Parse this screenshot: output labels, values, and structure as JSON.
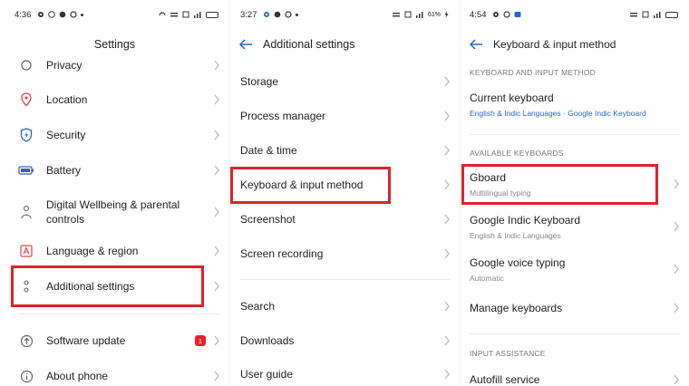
{
  "colors": {
    "accent": "#2a66c8",
    "highlight": "#e3202a",
    "badge": "#e8212b"
  },
  "screen1": {
    "status_time": "4:36",
    "title": "Settings",
    "items": [
      {
        "label": "Privacy",
        "icon": "privacy-icon"
      },
      {
        "label": "Location",
        "icon": "location-pin-icon"
      },
      {
        "label": "Security",
        "icon": "shield-icon"
      },
      {
        "label": "Battery",
        "icon": "battery-icon"
      },
      {
        "label": "Digital Wellbeing & parental controls",
        "icon": "wellbeing-icon"
      },
      {
        "label": "Language & region",
        "icon": "language-icon"
      },
      {
        "label": "Additional settings",
        "icon": "more-dots-icon"
      },
      {
        "label": "Software update",
        "icon": "update-icon",
        "badge": "1"
      },
      {
        "label": "About phone",
        "icon": "info-icon"
      }
    ]
  },
  "screen2": {
    "status_time": "3:27",
    "status_battery": "61%",
    "title": "Additional settings",
    "items": [
      {
        "label": "Storage"
      },
      {
        "label": "Process manager"
      },
      {
        "label": "Date & time"
      },
      {
        "label": "Keyboard & input method"
      },
      {
        "label": "Screenshot"
      },
      {
        "label": "Screen recording"
      },
      {
        "label": "Search"
      },
      {
        "label": "Downloads"
      },
      {
        "label": "User guide"
      }
    ]
  },
  "screen3": {
    "status_time": "4:54",
    "title": "Keyboard & input method",
    "section_keyboard": "KEYBOARD AND INPUT METHOD",
    "current_keyboard": {
      "label": "Current keyboard",
      "sub": "English & Indic Languages · Google Indic Keyboard"
    },
    "section_available": "AVAILABLE KEYBOARDS",
    "keyboards": [
      {
        "label": "Gboard",
        "sub": "Multilingual typing"
      },
      {
        "label": "Google Indic Keyboard",
        "sub": "English & Indic Languages"
      },
      {
        "label": "Google voice typing",
        "sub": "Automatic"
      },
      {
        "label": "Manage keyboards",
        "sub": ""
      }
    ],
    "section_assist": "INPUT ASSISTANCE",
    "autofill": "Autofill service"
  }
}
